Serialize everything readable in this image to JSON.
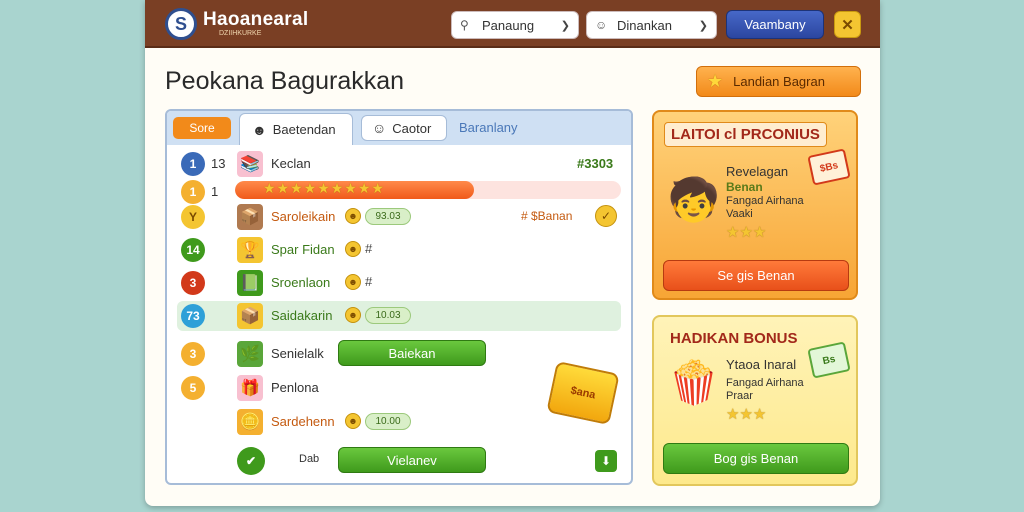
{
  "app": {
    "title": "Haoanearal",
    "subtitle": "DZIIHKURKE",
    "logo_letter": "S"
  },
  "topbar": {
    "dropdown1": "Panaung",
    "dropdown2": "Dinankan",
    "primary_button": "Vaambany",
    "icon_button_glyph": "✕"
  },
  "page": {
    "title": "Peokana Bagurakkan",
    "action_button": "Landian Bagran"
  },
  "panel": {
    "tabs": {
      "filter": "Sore",
      "active": "Baetendan",
      "secondary": "Caotor",
      "link": "Baranlany"
    },
    "top_score": "#3303",
    "right_label": "# $Banan",
    "progress": 0.62,
    "stars_text": "★★★★★★★★★",
    "rows": [
      {
        "num": "1",
        "rank": "13",
        "name": "Keclan",
        "name_color": "#333333"
      },
      {
        "num": "1",
        "rank": "1"
      },
      {
        "num": "Y",
        "name": "Saroleikain",
        "pill": "93.03",
        "name_color": "#c45a10"
      },
      {
        "num": "14",
        "name": "Spar Fidan",
        "hash": "#",
        "name_color": "#3a7a1a"
      },
      {
        "num": "3",
        "name": "Sroenlaon",
        "hash": "#",
        "name_color": "#3a7a1a"
      },
      {
        "num": "73",
        "name": "Saidakarin",
        "pill": "10.03",
        "name_color": "#3a7a1a"
      },
      {
        "num": "3",
        "name": "Senielalk",
        "button": "Baiekan",
        "name_color": "#333333"
      },
      {
        "num": "5",
        "name": "Penlona",
        "name_color": "#333333"
      },
      {
        "num": "",
        "name": "Sardehenn",
        "pill": "10.00",
        "name_color": "#c45a10"
      },
      {
        "num": "✔",
        "rank": "Dab",
        "button": "Vielanev"
      }
    ],
    "chest_label": "$ana"
  },
  "bonus1": {
    "title": "LAITOI cl PRCONIUS",
    "char_emoji": "🧒",
    "line1": "Revelagan",
    "line2": "Benan",
    "line3": "Fangad Airhana Vaaki",
    "stars": "★★★",
    "tag": "$Bs",
    "cta": "Se gis Benan"
  },
  "bonus2": {
    "title": "HADIKAN BONUS",
    "char_emoji": "🍿",
    "line1": "Ytaoa Inaral",
    "line3": "Fangad Airhana Praar",
    "stars": "★★★",
    "tag": "Bs",
    "cta": "Bog gis Benan"
  },
  "colors": {
    "topbar": "#7a3f24",
    "accent_orange": "#f28a1a",
    "accent_green": "#3f9a1c",
    "accent_blue": "#2b46a0"
  }
}
